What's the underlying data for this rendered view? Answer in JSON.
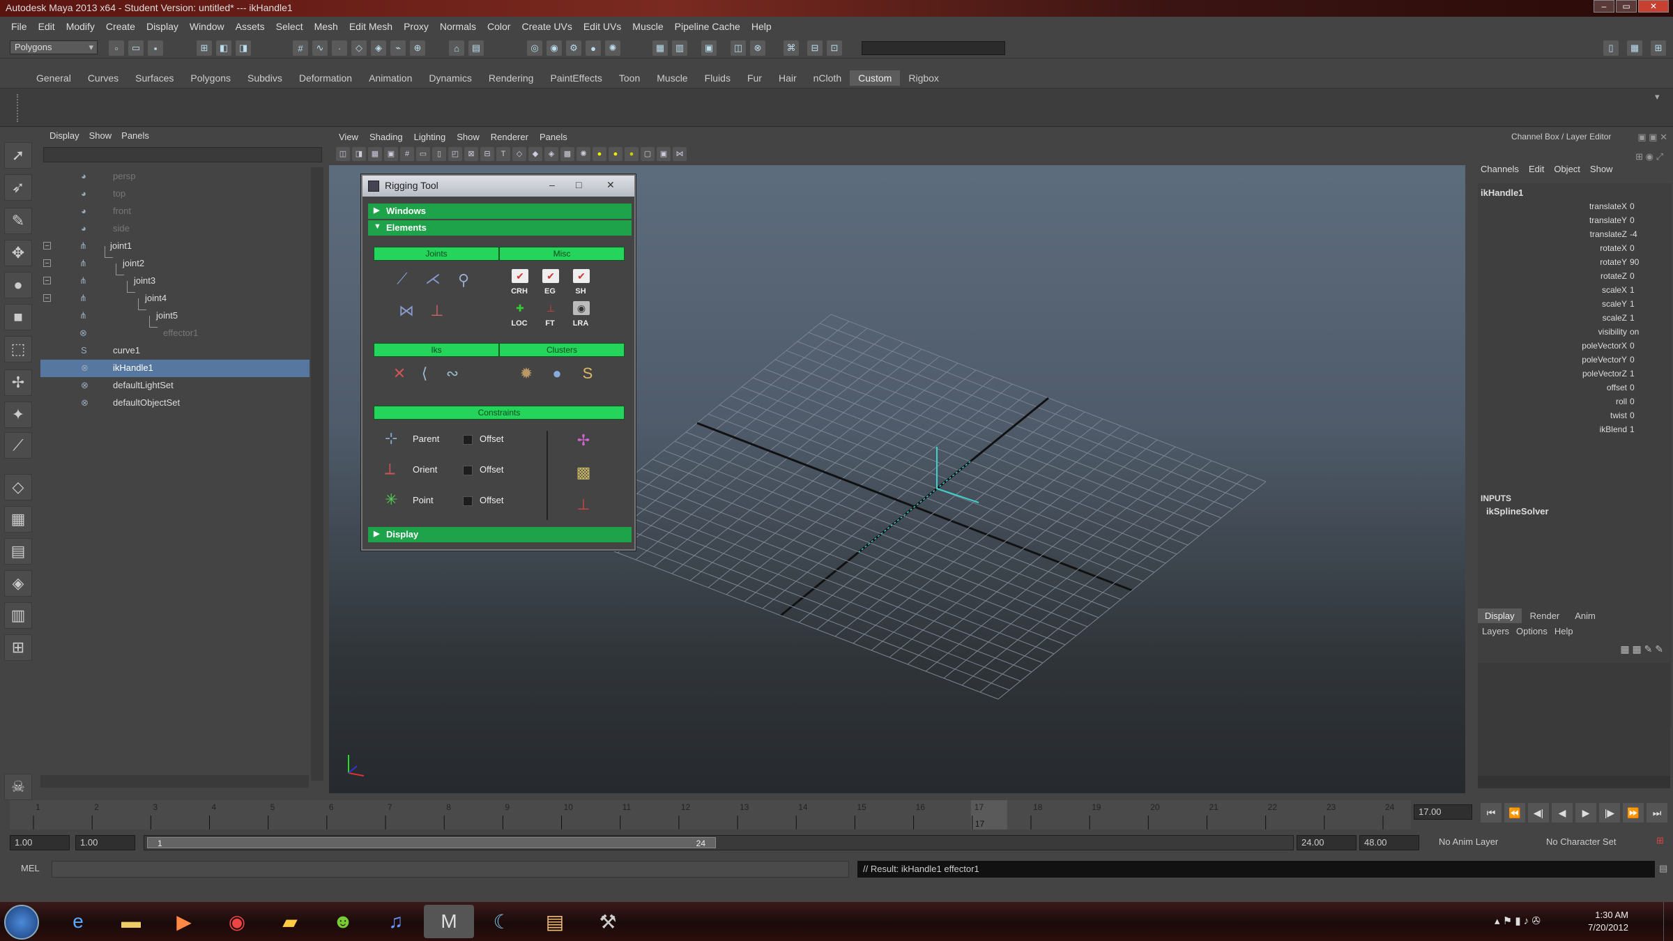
{
  "window": {
    "title": "Autodesk Maya 2013 x64 - Student Version: untitled*  ---  ikHandle1",
    "controls": [
      "–",
      "▭",
      "✕"
    ]
  },
  "menubar": [
    "File",
    "Edit",
    "Modify",
    "Create",
    "Display",
    "Window",
    "Assets",
    "Select",
    "Mesh",
    "Edit Mesh",
    "Proxy",
    "Normals",
    "Color",
    "Create UVs",
    "Edit UVs",
    "Muscle",
    "Pipeline Cache",
    "Help"
  ],
  "status": {
    "mode": "Polygons"
  },
  "shelf": {
    "tabs": [
      "General",
      "Curves",
      "Surfaces",
      "Polygons",
      "Subdivs",
      "Deformation",
      "Animation",
      "Dynamics",
      "Rendering",
      "PaintEffects",
      "Toon",
      "Muscle",
      "Fluids",
      "Fur",
      "Hair",
      "nCloth",
      "Custom",
      "Rigbox"
    ],
    "active": "Custom"
  },
  "outliner": {
    "menus": [
      "Display",
      "Show",
      "Panels"
    ],
    "items": [
      {
        "label": "persp",
        "dim": true
      },
      {
        "label": "top",
        "dim": true
      },
      {
        "label": "front",
        "dim": true
      },
      {
        "label": "side",
        "dim": true
      },
      {
        "label": "joint1",
        "exp": "–"
      },
      {
        "label": "joint2",
        "exp": "–"
      },
      {
        "label": "joint3",
        "exp": "–"
      },
      {
        "label": "joint4",
        "exp": "–"
      },
      {
        "label": "joint5"
      },
      {
        "label": "effector1",
        "dim": true
      },
      {
        "label": "curve1"
      },
      {
        "label": "ikHandle1",
        "sel": true
      },
      {
        "label": "defaultLightSet"
      },
      {
        "label": "defaultObjectSet"
      }
    ]
  },
  "viewport": {
    "menus": [
      "View",
      "Shading",
      "Lighting",
      "Show",
      "Renderer",
      "Panels"
    ]
  },
  "rigging": {
    "title": "Rigging Tool",
    "controls": [
      "–",
      "□",
      "✕"
    ],
    "frames": {
      "windows": "Windows",
      "elements": "Elements",
      "display": "Display"
    },
    "sections": {
      "joints": "Joints",
      "misc": "Misc",
      "iks": "Iks",
      "clusters": "Clusters",
      "constraints": "Constraints"
    },
    "misc_tags": [
      "CRH",
      "EG",
      "SH",
      "LOC",
      "FT",
      "LRA"
    ],
    "constraints": [
      {
        "name": "Parent",
        "offset": "Offset"
      },
      {
        "name": "Orient",
        "offset": "Offset"
      },
      {
        "name": "Point",
        "offset": "Offset"
      }
    ]
  },
  "channel": {
    "header": "Channel Box / Layer Editor",
    "menus": [
      "Channels",
      "Edit",
      "Object",
      "Show"
    ],
    "node": "ikHandle1",
    "attrs": [
      [
        "translateX",
        "0"
      ],
      [
        "translateY",
        "0"
      ],
      [
        "translateZ",
        "-4"
      ],
      [
        "rotateX",
        "0"
      ],
      [
        "rotateY",
        "90"
      ],
      [
        "rotateZ",
        "0"
      ],
      [
        "scaleX",
        "1"
      ],
      [
        "scaleY",
        "1"
      ],
      [
        "scaleZ",
        "1"
      ],
      [
        "visibility",
        "on"
      ],
      [
        "poleVectorX",
        "0"
      ],
      [
        "poleVectorY",
        "0"
      ],
      [
        "poleVectorZ",
        "1"
      ],
      [
        "offset",
        "0"
      ],
      [
        "roll",
        "0"
      ],
      [
        "twist",
        "0"
      ],
      [
        "ikBlend",
        "1"
      ]
    ],
    "inputs_label": "INPUTS",
    "input_node": "ikSplineSolver",
    "layer_tabs": [
      "Display",
      "Render",
      "Anim"
    ],
    "layer_menus": [
      "Layers",
      "Options",
      "Help"
    ]
  },
  "timeline": {
    "start": 1,
    "end": 24,
    "current": 17,
    "current_field": "17.00",
    "current_marker": "17"
  },
  "range": {
    "start": "1.00",
    "start2": "1.00",
    "bar_start": "1",
    "bar_end": "24",
    "end": "24.00",
    "end2": "48.00",
    "anim_layer": "No Anim Layer",
    "char_set": "No Character Set"
  },
  "cmd": {
    "label": "MEL",
    "result": "// Result: ikHandle1 effector1"
  },
  "taskbar": {
    "time": "1:30 AM",
    "date": "7/20/2012"
  },
  "colors": {
    "green": "#1fa34a",
    "bright_green": "#25d45a",
    "selection": "#5577a0"
  }
}
